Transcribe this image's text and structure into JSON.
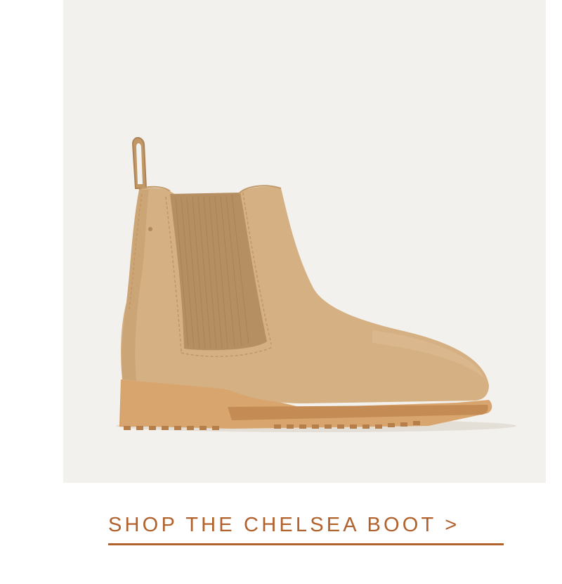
{
  "page": {
    "background_color": "#ffffff",
    "panel_color": "#f3f1ed"
  },
  "product": {
    "image_subject": "chelsea-boot",
    "colors": {
      "suede": "#d5b083",
      "suede_shadow": "#bf9767",
      "elastic": "#b48e61",
      "sole": "#d4a06b",
      "sole_dark": "#b98754"
    }
  },
  "cta": {
    "label": "SHOP THE CHELSEA BOOT >",
    "color": "#b0612c"
  }
}
